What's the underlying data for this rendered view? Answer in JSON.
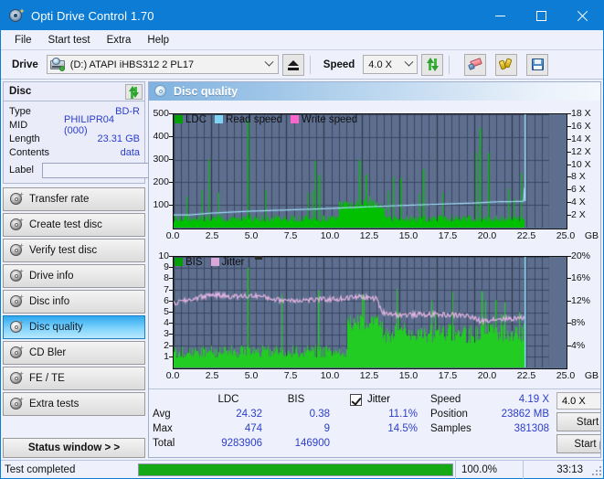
{
  "window": {
    "title": "Opti Drive Control 1.70",
    "icon": "disc-icon",
    "minimize": "minimize",
    "maximize": "maximize",
    "close": "close"
  },
  "menu": {
    "items": [
      "File",
      "Start test",
      "Extra",
      "Help"
    ]
  },
  "toolbar": {
    "drive_label": "Drive",
    "drive_value": "(D:)  ATAPI iHBS312  2 PL17",
    "eject_icon": "eject-icon",
    "speed_label": "Speed",
    "speed_value": "4.0 X",
    "refresh_icon": "refresh-icon",
    "eraser_icon": "eraser-icon",
    "tools_icon": "tools-icon",
    "save_icon": "save-icon"
  },
  "sidebar": {
    "disc_panel": {
      "title": "Disc",
      "refresh_icon": "refresh-icon",
      "rows": [
        {
          "key": "Type",
          "value": "BD-R"
        },
        {
          "key": "MID",
          "value": "PHILIPR04 (000)"
        },
        {
          "key": "Length",
          "value": "23.31 GB"
        },
        {
          "key": "Contents",
          "value": "data"
        }
      ],
      "label_key": "Label",
      "label_value": "",
      "label_placeholder": "",
      "disc_button_icon": "cd-icon"
    },
    "nav": [
      {
        "label": "Transfer rate",
        "selected": false
      },
      {
        "label": "Create test disc",
        "selected": false
      },
      {
        "label": "Verify test disc",
        "selected": false
      },
      {
        "label": "Drive info",
        "selected": false
      },
      {
        "label": "Disc info",
        "selected": false
      },
      {
        "label": "Disc quality",
        "selected": true
      },
      {
        "label": "CD Bler",
        "selected": false
      },
      {
        "label": "FE / TE",
        "selected": false
      },
      {
        "label": "Extra tests",
        "selected": false
      }
    ],
    "status_window_button": "Status window > >"
  },
  "main": {
    "header_title": "Disc quality",
    "header_icon": "disc-quality-icon"
  },
  "stats": {
    "col_headers": [
      "LDC",
      "BIS"
    ],
    "rows": [
      {
        "label": "Avg",
        "ldc": "24.32",
        "bis": "0.38"
      },
      {
        "label": "Max",
        "ldc": "474",
        "bis": "9"
      },
      {
        "label": "Total",
        "ldc": "9283906",
        "bis": "146900"
      }
    ],
    "jitter": {
      "checkbox_checked": true,
      "label": "Jitter",
      "avg": "11.1%",
      "max": "14.5%"
    },
    "speed_key": "Speed",
    "speed_value": "4.19 X",
    "position_key": "Position",
    "position_value": "23862 MB",
    "samples_key": "Samples",
    "samples_value": "381308",
    "speed_select": "4.0 X",
    "start_full": "Start full",
    "start_part": "Start part"
  },
  "statusbar": {
    "text": "Test completed",
    "progress_pct": "100.0%",
    "progress_value": 100,
    "elapsed": "33:13"
  },
  "chart_data": [
    {
      "id": "top",
      "type": "area",
      "title": "",
      "xlabel": "GB",
      "legend": [
        {
          "name": "LDC",
          "color": "#00a000"
        },
        {
          "name": "Read speed",
          "color": "#7fd4f4"
        },
        {
          "name": "Write speed",
          "color": "#ff66cc"
        }
      ],
      "legend_position": "top-left",
      "grid": true,
      "x": {
        "ticks": [
          0.0,
          2.5,
          5.0,
          7.5,
          10.0,
          12.5,
          15.0,
          17.5,
          20.0,
          22.5,
          25.0
        ],
        "tick_labels": [
          "0.0",
          "2.5",
          "5.0",
          "7.5",
          "10.0",
          "12.5",
          "15.0",
          "17.5",
          "20.0",
          "22.5",
          "25.0"
        ],
        "lim": [
          0,
          25
        ],
        "unit": "GB"
      },
      "y_left": {
        "ticks": [
          100,
          200,
          300,
          400,
          500
        ],
        "tick_labels": [
          "100",
          "200",
          "300",
          "400",
          "500"
        ],
        "lim": [
          0,
          500
        ],
        "label": "LDC"
      },
      "y_right": {
        "ticks": [
          2,
          4,
          6,
          8,
          10,
          12,
          14,
          16,
          18
        ],
        "tick_labels": [
          "2 X",
          "4 X",
          "6 X",
          "8 X",
          "10 X",
          "12 X",
          "14 X",
          "16 X",
          "18 X"
        ],
        "lim": [
          0,
          18
        ],
        "label": "Speed"
      },
      "data_end_gb": 23.4,
      "series": [
        {
          "name": "LDC",
          "kind": "spikes",
          "axis": "left",
          "color": "#00c000",
          "baseline": 55,
          "avg": 24.32,
          "max": 474,
          "notable_spikes": [
            [
              4.95,
              474
            ],
            [
              12.35,
              298
            ],
            [
              20.4,
              440
            ],
            [
              20.95,
              330
            ],
            [
              16.6,
              258
            ],
            [
              12.8,
              235
            ],
            [
              9.7,
              232
            ],
            [
              15.1,
              218
            ]
          ]
        },
        {
          "name": "Read speed",
          "kind": "line",
          "axis": "right",
          "color": "#9fe0f8",
          "points": [
            [
              0.0,
              2.0
            ],
            [
              1.0,
              2.0
            ],
            [
              2.5,
              2.3
            ],
            [
              5.0,
              2.6
            ],
            [
              7.5,
              2.8
            ],
            [
              10.0,
              3.0
            ],
            [
              12.0,
              3.2
            ],
            [
              13.8,
              3.4
            ],
            [
              15.0,
              3.5
            ],
            [
              17.5,
              3.7
            ],
            [
              20.0,
              3.9
            ],
            [
              21.5,
              4.1
            ],
            [
              23.0,
              4.15
            ],
            [
              23.35,
              4.2
            ],
            [
              23.4,
              18.0
            ]
          ]
        },
        {
          "name": "Write speed",
          "kind": "none",
          "axis": "right",
          "color": "#ff66cc",
          "points": []
        }
      ]
    },
    {
      "id": "bottom",
      "type": "area",
      "title": "",
      "xlabel": "GB",
      "legend": [
        {
          "name": "BIS",
          "color": "#00a000"
        },
        {
          "name": "Jitter",
          "color": "#d9a8d9"
        }
      ],
      "legend_position": "top-left",
      "grid": true,
      "x": {
        "ticks": [
          0.0,
          2.5,
          5.0,
          7.5,
          10.0,
          12.5,
          15.0,
          17.5,
          20.0,
          22.5,
          25.0
        ],
        "tick_labels": [
          "0.0",
          "2.5",
          "5.0",
          "7.5",
          "10.0",
          "12.5",
          "15.0",
          "17.5",
          "20.0",
          "22.5",
          "25.0"
        ],
        "lim": [
          0,
          25
        ],
        "unit": "GB"
      },
      "y_left": {
        "ticks": [
          1,
          2,
          3,
          4,
          5,
          6,
          7,
          8,
          9,
          10
        ],
        "tick_labels": [
          "1",
          "2",
          "3",
          "4",
          "5",
          "6",
          "7",
          "8",
          "9",
          "10"
        ],
        "lim": [
          0,
          10
        ],
        "label": "BIS"
      },
      "y_right": {
        "ticks": [
          4,
          8,
          12,
          16,
          20
        ],
        "tick_labels": [
          "4%",
          "8%",
          "12%",
          "16%",
          "20%"
        ],
        "lim": [
          0,
          20
        ],
        "label": "Jitter"
      },
      "data_end_gb": 23.4,
      "series": [
        {
          "name": "BIS",
          "kind": "spikes",
          "axis": "left",
          "color": "#22cc22",
          "baseline": 2.0,
          "avg": 0.38,
          "max": 9,
          "notable_spikes": [
            [
              4.95,
              9.0
            ],
            [
              9.6,
              7.0
            ],
            [
              12.5,
              6.6
            ],
            [
              20.5,
              6.9
            ],
            [
              21.4,
              6.1
            ]
          ]
        },
        {
          "name": "Jitter",
          "kind": "line",
          "axis": "right",
          "color": "#e2b4e2",
          "segment1_pct": 12.6,
          "segment2_pct": 9.4,
          "break_gb": 13.9,
          "points": [
            [
              0.0,
              11.6
            ],
            [
              1.0,
              12.2
            ],
            [
              2.5,
              13.2
            ],
            [
              4.0,
              12.8
            ],
            [
              5.5,
              13.0
            ],
            [
              7.0,
              12.2
            ],
            [
              9.0,
              12.2
            ],
            [
              11.0,
              12.4
            ],
            [
              12.5,
              12.8
            ],
            [
              13.5,
              12.4
            ],
            [
              13.9,
              10.0
            ],
            [
              15.0,
              9.5
            ],
            [
              17.5,
              9.6
            ],
            [
              19.5,
              9.4
            ],
            [
              20.4,
              8.4
            ],
            [
              21.5,
              8.8
            ],
            [
              23.0,
              8.9
            ],
            [
              23.35,
              9.0
            ]
          ]
        }
      ]
    }
  ]
}
